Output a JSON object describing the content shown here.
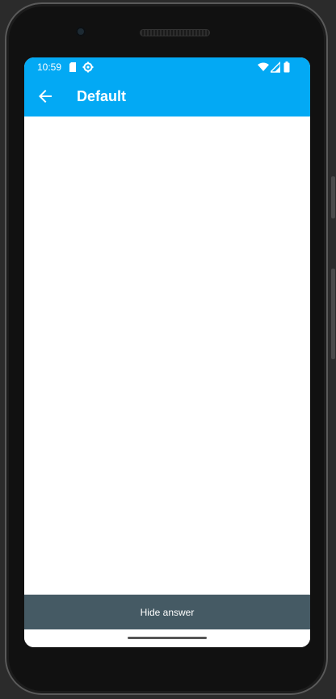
{
  "status_bar": {
    "time": "10:59",
    "left_icons": [
      "sd-card-icon",
      "settings-gear-icon"
    ],
    "right_icons": [
      "wifi-icon",
      "cell-signal-icon",
      "battery-icon"
    ],
    "background": "#03a9f4"
  },
  "app_bar": {
    "title": "Default",
    "back_icon": "arrow-back-icon",
    "background": "#03a9f4"
  },
  "bottom_bar": {
    "button_label": "Hide answer",
    "background": "#455a64"
  },
  "colors": {
    "accent": "#03a9f4",
    "bottom_bar": "#455a64",
    "content_background": "#ffffff"
  }
}
